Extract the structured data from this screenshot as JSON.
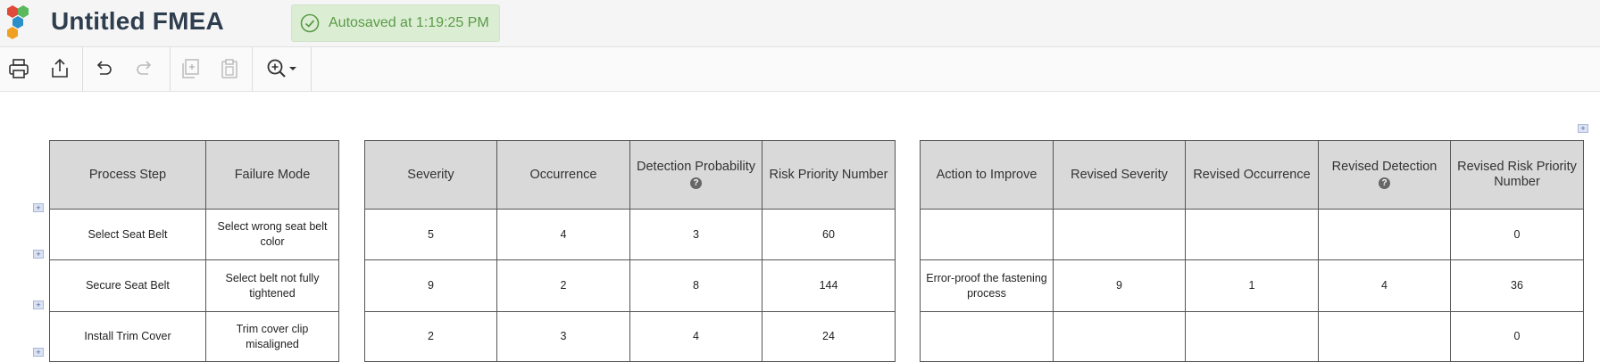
{
  "app": {
    "title": "Untitled FMEA",
    "autosave_text": "Autosaved at 1:19:25 PM"
  },
  "toolbar": {
    "icons": [
      "print-icon",
      "export-icon",
      "undo-icon",
      "redo-icon",
      "duplicate-icon",
      "paste-icon",
      "zoom-icon"
    ]
  },
  "tables": {
    "process": {
      "headers": [
        "Process Step",
        "Failure Mode"
      ],
      "rows": [
        [
          "Select Seat Belt",
          "Select wrong seat belt color"
        ],
        [
          "Secure Seat Belt",
          "Select belt not fully tightened"
        ],
        [
          "Install Trim Cover",
          "Trim cover clip misaligned"
        ]
      ]
    },
    "risk": {
      "headers": [
        "Severity",
        "Occurrence",
        "Detection Probability",
        "Risk Priority Number"
      ],
      "rows": [
        [
          "5",
          "4",
          "3",
          "60"
        ],
        [
          "9",
          "2",
          "8",
          "144"
        ],
        [
          "2",
          "3",
          "4",
          "24"
        ]
      ]
    },
    "action": {
      "headers": [
        "Action to Improve",
        "Revised Severity",
        "Revised Occurrence",
        "Revised Detection",
        "Revised Risk Priority Number"
      ],
      "rows": [
        [
          "",
          "",
          "",
          "",
          "0"
        ],
        [
          "Error-proof the fastening process",
          "9",
          "1",
          "4",
          "36"
        ],
        [
          "",
          "",
          "",
          "",
          "0"
        ]
      ]
    }
  },
  "help_marker": "?",
  "add_marker": "+"
}
